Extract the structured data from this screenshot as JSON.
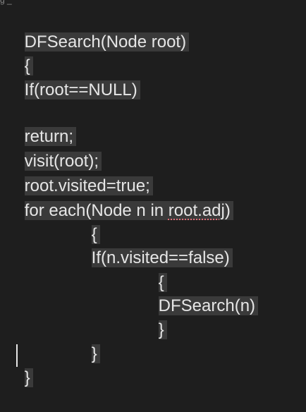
{
  "top_partial_text": "g    _               ",
  "code": {
    "line1": "DFSearch(Node root)",
    "line2": "{",
    "line3": "If(root==NULL)",
    "line4": "return;",
    "line5": "visit(root);",
    "line6": "root.visited=true;",
    "line7_prefix": "for each(Node n in ",
    "line7_squiggle": "root.adj",
    "line7_suffix": ")",
    "line8": "{",
    "line9": "If(n.visited==false)",
    "line10": "{",
    "line11": "DFSearch(n)",
    "line12": "}",
    "line13": "}",
    "line14": "}"
  },
  "colors": {
    "background": "#1e1e1e",
    "text": "#e6e6e6",
    "selection": "#3a3a3a",
    "squiggle": "#e06c75"
  }
}
